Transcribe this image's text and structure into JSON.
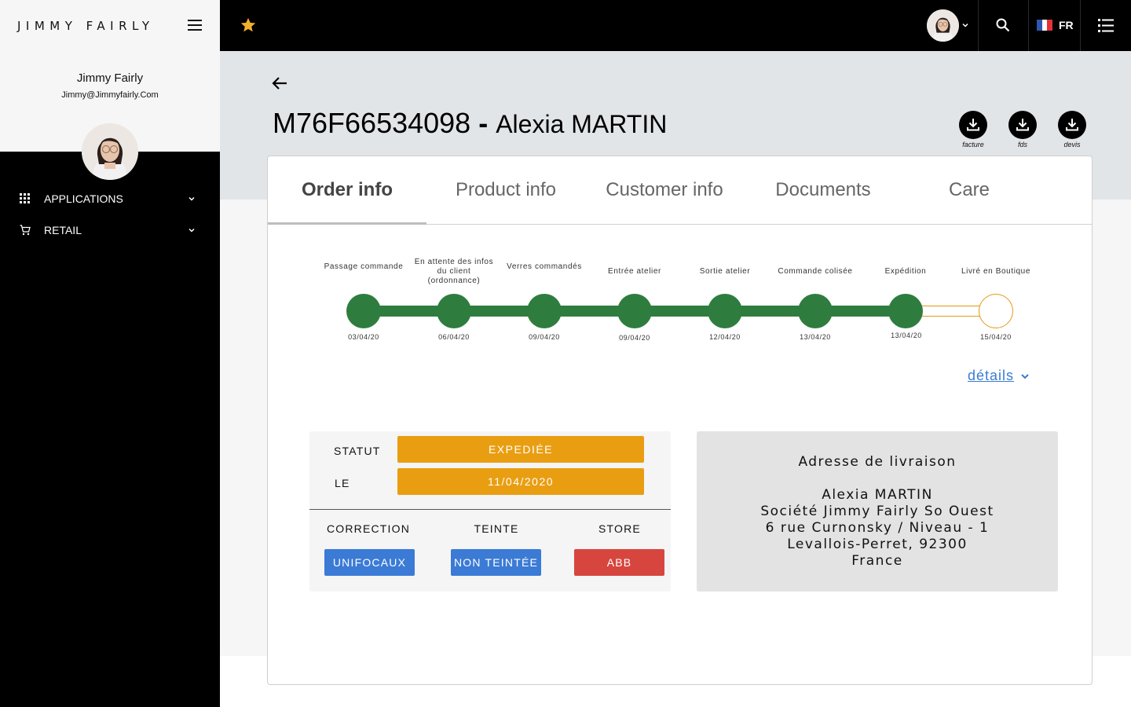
{
  "brand": "JIMMY FAIRLY",
  "user": {
    "name": "Jimmy Fairly",
    "email": "Jimmy@Jimmyfairly.Com"
  },
  "sidebar": {
    "items": [
      {
        "label": "APPLICATIONS",
        "icon": "grid-icon"
      },
      {
        "label": "RETAIL",
        "icon": "cart-icon"
      }
    ]
  },
  "topbar": {
    "language": "FR"
  },
  "order": {
    "id": "M76F66534098",
    "separator": " - ",
    "customer": "Alexia MARTIN"
  },
  "downloads": [
    {
      "label": "facture"
    },
    {
      "label": "fds"
    },
    {
      "label": "devis"
    }
  ],
  "tabs": [
    "Order info",
    "Product info",
    "Customer info",
    "Documents",
    "Care"
  ],
  "active_tab": "Order info",
  "timeline": [
    {
      "label": "Passage commande",
      "date": "03/04/20",
      "done": true
    },
    {
      "label": "En attente des infos du client (ordonnance)",
      "date": "06/04/20",
      "done": true
    },
    {
      "label": "Verres commandés",
      "date": "09/04/20",
      "done": true
    },
    {
      "label": "Entrée atelier",
      "date": "09/04/20",
      "done": true
    },
    {
      "label": "Sortie atelier",
      "date": "12/04/20",
      "done": true
    },
    {
      "label": "Commande colisée",
      "date": "13/04/20",
      "done": true
    },
    {
      "label": "Expédition",
      "date": "13/04/20",
      "done": true
    },
    {
      "label": "Livré en Boutique",
      "date": "15/04/20",
      "done": false
    }
  ],
  "details_link": "détails",
  "status": {
    "statut_label": "STATUT",
    "statut_value": "EXPEDIÉE",
    "le_label": "LE",
    "le_value": "11/04/2020",
    "correction_label": "CORRECTION",
    "correction_value": "UNIFOCAUX",
    "teinte_label": "TEINTE",
    "teinte_value": "NON TEINTÉE",
    "store_label": "STORE",
    "store_value": "ABB"
  },
  "address": {
    "title": "Adresse de livraison",
    "lines": [
      "Alexia MARTIN",
      "Société Jimmy Fairly So Ouest",
      "6 rue Curnonsky / Niveau - 1",
      "Levallois-Perret, 92300",
      "France"
    ]
  },
  "colors": {
    "done": "#2e7d3e",
    "pending": "#e39b17",
    "status_pill": "#e99e12",
    "blue_button": "#3b7bd6",
    "red_button": "#d6463f",
    "star": "#f2b02a"
  }
}
